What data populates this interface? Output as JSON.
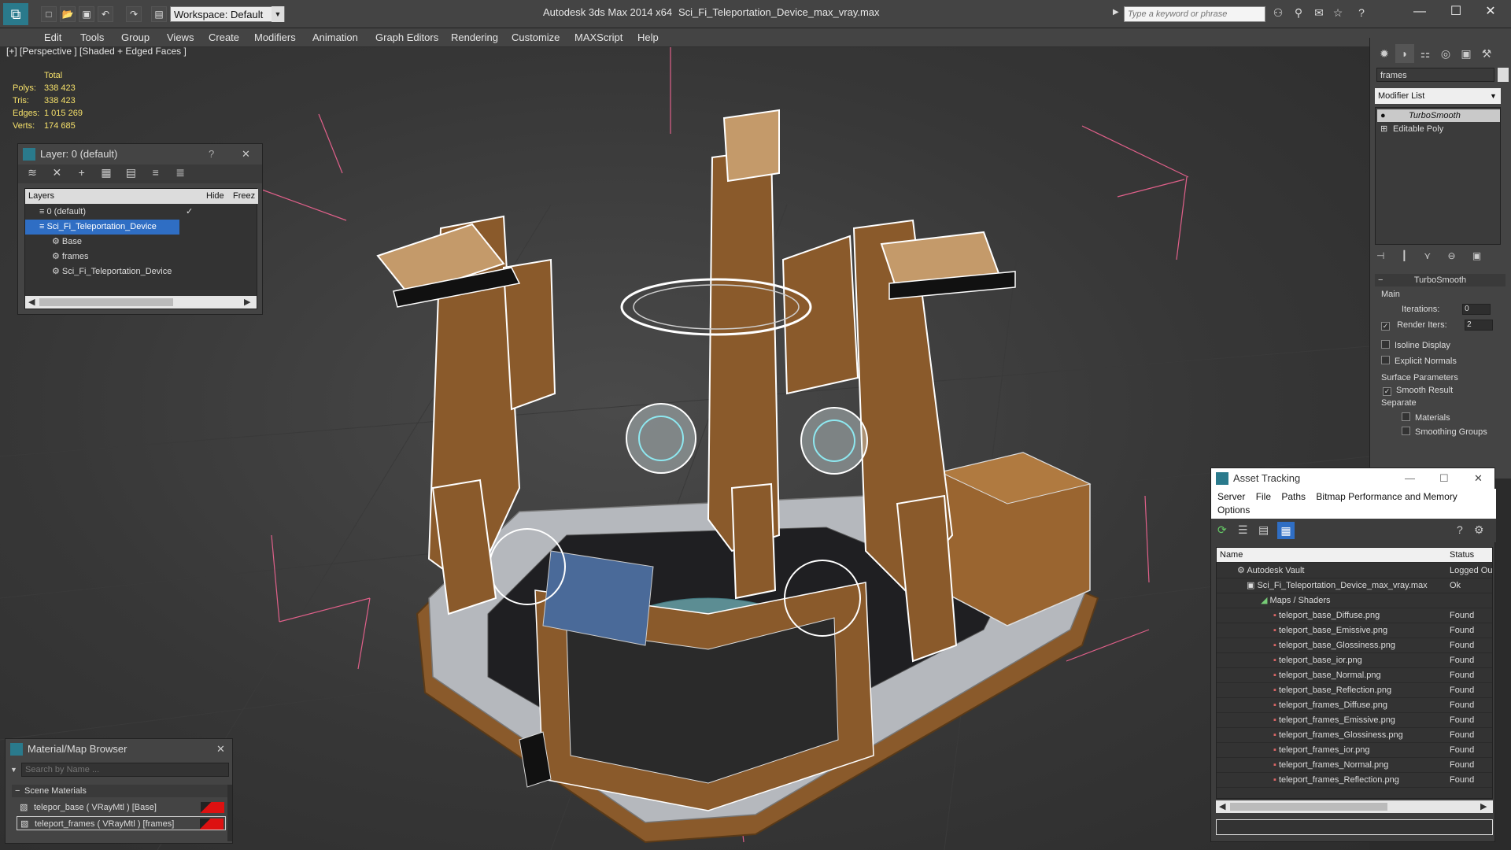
{
  "titlebar": {
    "workspace_label": "Workspace: Default",
    "app_title": "Autodesk 3ds Max  2014 x64",
    "file_title": "Sci_Fi_Teleportation_Device_max_vray.max",
    "search_placeholder": "Type a keyword or phrase"
  },
  "menu": [
    "Edit",
    "Tools",
    "Group",
    "Views",
    "Create",
    "Modifiers",
    "Animation",
    "Graph Editors",
    "Rendering",
    "Customize",
    "MAXScript",
    "Help"
  ],
  "viewport": {
    "label": "[+] [Perspective ] [Shaded + Edged Faces ]",
    "stats": {
      "total_label": "Total",
      "polys_label": "Polys:",
      "polys": "338 423",
      "tris_label": "Tris:",
      "tris": "338 423",
      "edges_label": "Edges:",
      "edges": "1 015 269",
      "verts_label": "Verts:",
      "verts": "174 685"
    }
  },
  "layer_panel": {
    "title": "Layer: 0 (default)",
    "col_layers": "Layers",
    "col_hide": "Hide",
    "col_freeze": "Freez",
    "rows": [
      "0 (default)",
      "Sci_Fi_Teleportation_Device",
      "Base",
      "frames",
      "Sci_Fi_Teleportation_Device"
    ]
  },
  "command_panel": {
    "object_name": "frames",
    "modifier_list": "Modifier List",
    "stack": [
      "TurboSmooth",
      "Editable Poly"
    ],
    "rollout_title": "TurboSmooth",
    "main_label": "Main",
    "iterations_label": "Iterations:",
    "iterations": "0",
    "render_iters_label": "Render Iters:",
    "render_iters": "2",
    "isoline_label": "Isoline Display",
    "explicit_normals_label": "Explicit Normals",
    "surface_params_label": "Surface Parameters",
    "smooth_result_label": "Smooth Result",
    "separate_label": "Separate",
    "materials_label": "Materials",
    "smoothing_groups_label": "Smoothing Groups"
  },
  "asset_tracking": {
    "title": "Asset Tracking",
    "menu": [
      "Server",
      "File",
      "Paths",
      "Bitmap Performance and Memory",
      "Options"
    ],
    "col_name": "Name",
    "col_status": "Status",
    "rows": [
      {
        "name": "Autodesk Vault",
        "status": "Logged Ou"
      },
      {
        "name": "Sci_Fi_Teleportation_Device_max_vray.max",
        "status": "Ok"
      },
      {
        "name": "Maps / Shaders",
        "status": ""
      },
      {
        "name": "teleport_base_Diffuse.png",
        "status": "Found"
      },
      {
        "name": "teleport_base_Emissive.png",
        "status": "Found"
      },
      {
        "name": "teleport_base_Glossiness.png",
        "status": "Found"
      },
      {
        "name": "teleport_base_ior.png",
        "status": "Found"
      },
      {
        "name": "teleport_base_Normal.png",
        "status": "Found"
      },
      {
        "name": "teleport_base_Reflection.png",
        "status": "Found"
      },
      {
        "name": "teleport_frames_Diffuse.png",
        "status": "Found"
      },
      {
        "name": "teleport_frames_Emissive.png",
        "status": "Found"
      },
      {
        "name": "teleport_frames_Glossiness.png",
        "status": "Found"
      },
      {
        "name": "teleport_frames_ior.png",
        "status": "Found"
      },
      {
        "name": "teleport_frames_Normal.png",
        "status": "Found"
      },
      {
        "name": "teleport_frames_Reflection.png",
        "status": "Found"
      }
    ]
  },
  "material_browser": {
    "title": "Material/Map Browser",
    "search_placeholder": "Search by Name ...",
    "group_label": "Scene Materials",
    "items": [
      "telepor_base ( VRayMtl ) [Base]",
      "teleport_frames ( VRayMtl ) [frames]"
    ]
  },
  "colors": {
    "accent": "#2f6ec4",
    "stats_text": "#f5e06a",
    "wire": "#ffffff",
    "wood": "#8a5a2b",
    "metal": "#9aa0a8",
    "glow": "#8ee8f0",
    "gizmo": "#e0608a"
  }
}
